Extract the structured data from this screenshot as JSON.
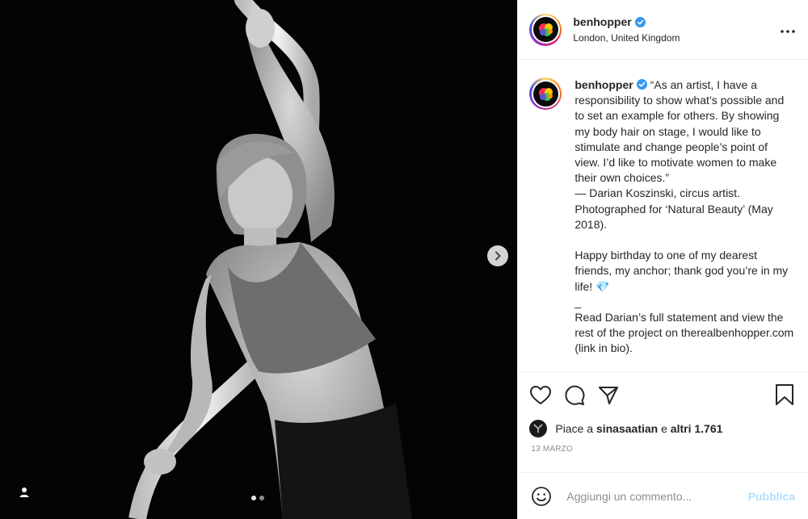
{
  "post": {
    "username": "benhopper",
    "location": "London, United Kingdom",
    "caption": "“As an artist, I have a responsibility to show what’s possible and to set an example for others. By showing my body hair on stage, I would like to stimulate and change people’s point of view. I’d like to motivate women to make their own choices.”\n— Darian Koszinski, circus artist.\nPhotographed for ‘Natural Beauty’ (May 2018).\n\nHappy birthday to one of my dearest friends, my anchor; thank god you’re in my life! 💎\n_\nRead Darian’s full statement and view the rest of the project on therealbenhopper.com (link in bio).",
    "likes_prefix": "Piace a",
    "likes_user": "sinasaatian",
    "likes_mid": "e",
    "likes_count": "altri 1.761",
    "date": "13 MARZO",
    "carousel": {
      "total": 2,
      "current": 1
    }
  },
  "comment": {
    "placeholder": "Aggiungi un commento...",
    "publish_label": "Pubblica"
  },
  "colors": {
    "verified": "#3897f0",
    "publish_disabled": "#b2dffc",
    "muted": "#8e8e8e"
  },
  "icons": [
    "next-arrow-icon",
    "user-tag-icon",
    "verified-badge-icon",
    "more-options-icon",
    "heart-icon",
    "comment-icon",
    "share-icon",
    "bookmark-icon",
    "emoji-icon"
  ]
}
